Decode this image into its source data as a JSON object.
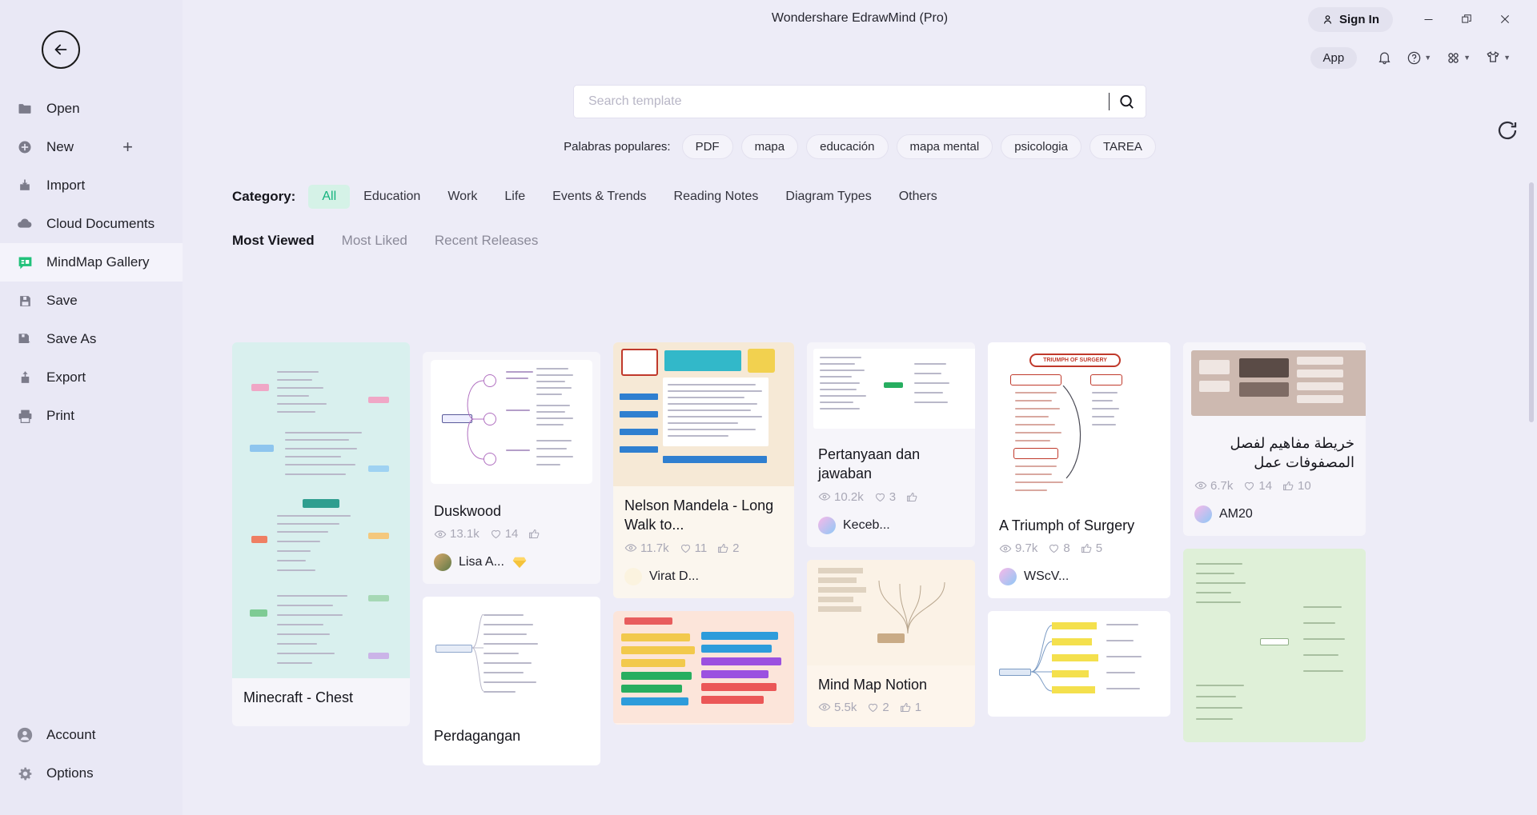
{
  "window": {
    "title": "Wondershare EdrawMind (Pro)",
    "sign_in": "Sign In",
    "minimize_icon": "minimize-icon",
    "restore_icon": "restore-icon",
    "close_icon": "close-icon"
  },
  "toolbar": {
    "app_label": "App",
    "bell_icon": "notification-bell-icon",
    "help_icon": "help-circle-icon",
    "grid_icon": "apps-grid-icon",
    "theme_icon": "shirt-theme-icon"
  },
  "sidebar": {
    "back_icon": "back-arrow-icon",
    "items": [
      {
        "label": "Open",
        "icon": "folder-icon"
      },
      {
        "label": "New",
        "icon": "plus-circle-icon",
        "trailing": "+"
      },
      {
        "label": "Import",
        "icon": "import-icon"
      },
      {
        "label": "Cloud Documents",
        "icon": "cloud-icon"
      },
      {
        "label": "MindMap Gallery",
        "icon": "gallery-icon",
        "active": true
      },
      {
        "label": "Save",
        "icon": "save-icon"
      },
      {
        "label": "Save As",
        "icon": "save-as-icon"
      },
      {
        "label": "Export",
        "icon": "export-icon"
      },
      {
        "label": "Print",
        "icon": "print-icon"
      }
    ],
    "bottom_items": [
      {
        "label": "Account",
        "icon": "account-icon"
      },
      {
        "label": "Options",
        "icon": "gear-icon"
      }
    ]
  },
  "search": {
    "placeholder": "Search template",
    "value": "",
    "search_icon": "search-icon"
  },
  "keywords": {
    "label": "Palabras populares:",
    "items": [
      "PDF",
      "mapa",
      "educación",
      "mapa mental",
      "psicologia",
      "TAREA"
    ]
  },
  "categories": {
    "label": "Category:",
    "items": [
      "All",
      "Education",
      "Work",
      "Life",
      "Events & Trends",
      "Reading Notes",
      "Diagram Types",
      "Others"
    ],
    "active": "All"
  },
  "tabs": {
    "items": [
      "Most Viewed",
      "Most Liked",
      "Recent Releases"
    ],
    "active": "Most Viewed"
  },
  "refresh_icon": "refresh-icon",
  "cards": {
    "c1": {
      "title": "Minecraft - Chest",
      "views": "",
      "likes": "",
      "thumbs": "",
      "author": ""
    },
    "c2": {
      "title": "Duskwood",
      "views": "13.1k",
      "likes": "14",
      "thumbs": "",
      "author": "Lisa A...",
      "badge": "diamond-badge-icon"
    },
    "c3": {
      "title": "Perdagangan",
      "views": "",
      "likes": "",
      "thumbs": "",
      "author": ""
    },
    "c4": {
      "title": "Nelson Mandela - Long Walk to...",
      "views": "11.7k",
      "likes": "11",
      "thumbs": "2",
      "author": "Virat D..."
    },
    "c5": {
      "title": "Pertanyaan dan jawaban",
      "views": "10.2k",
      "likes": "3",
      "thumbs": "",
      "author": "Keceb..."
    },
    "c6": {
      "title": "Mind Map Notion",
      "views": "5.5k",
      "likes": "2",
      "thumbs": "1",
      "author": ""
    },
    "c7": {
      "title": "A Triumph of Surgery",
      "views": "9.7k",
      "likes": "8",
      "thumbs": "5",
      "author": "WScV...",
      "thumb_heading": "TRIUMPH OF SURGERY"
    },
    "c8": {
      "title": "خريطة مفاهيم لفصل المصفوفات عمل",
      "views": "6.7k",
      "likes": "14",
      "thumbs": "10",
      "author": "AM20"
    }
  },
  "icons": {
    "eye": "eye-icon",
    "heart": "heart-icon",
    "thumb": "thumbs-up-icon"
  },
  "colors": {
    "accent_green": "#14b37d",
    "sidebar_bg": "#e9e8f5",
    "page_bg": "#edecf7",
    "card_bg": "#f6f5fa"
  }
}
